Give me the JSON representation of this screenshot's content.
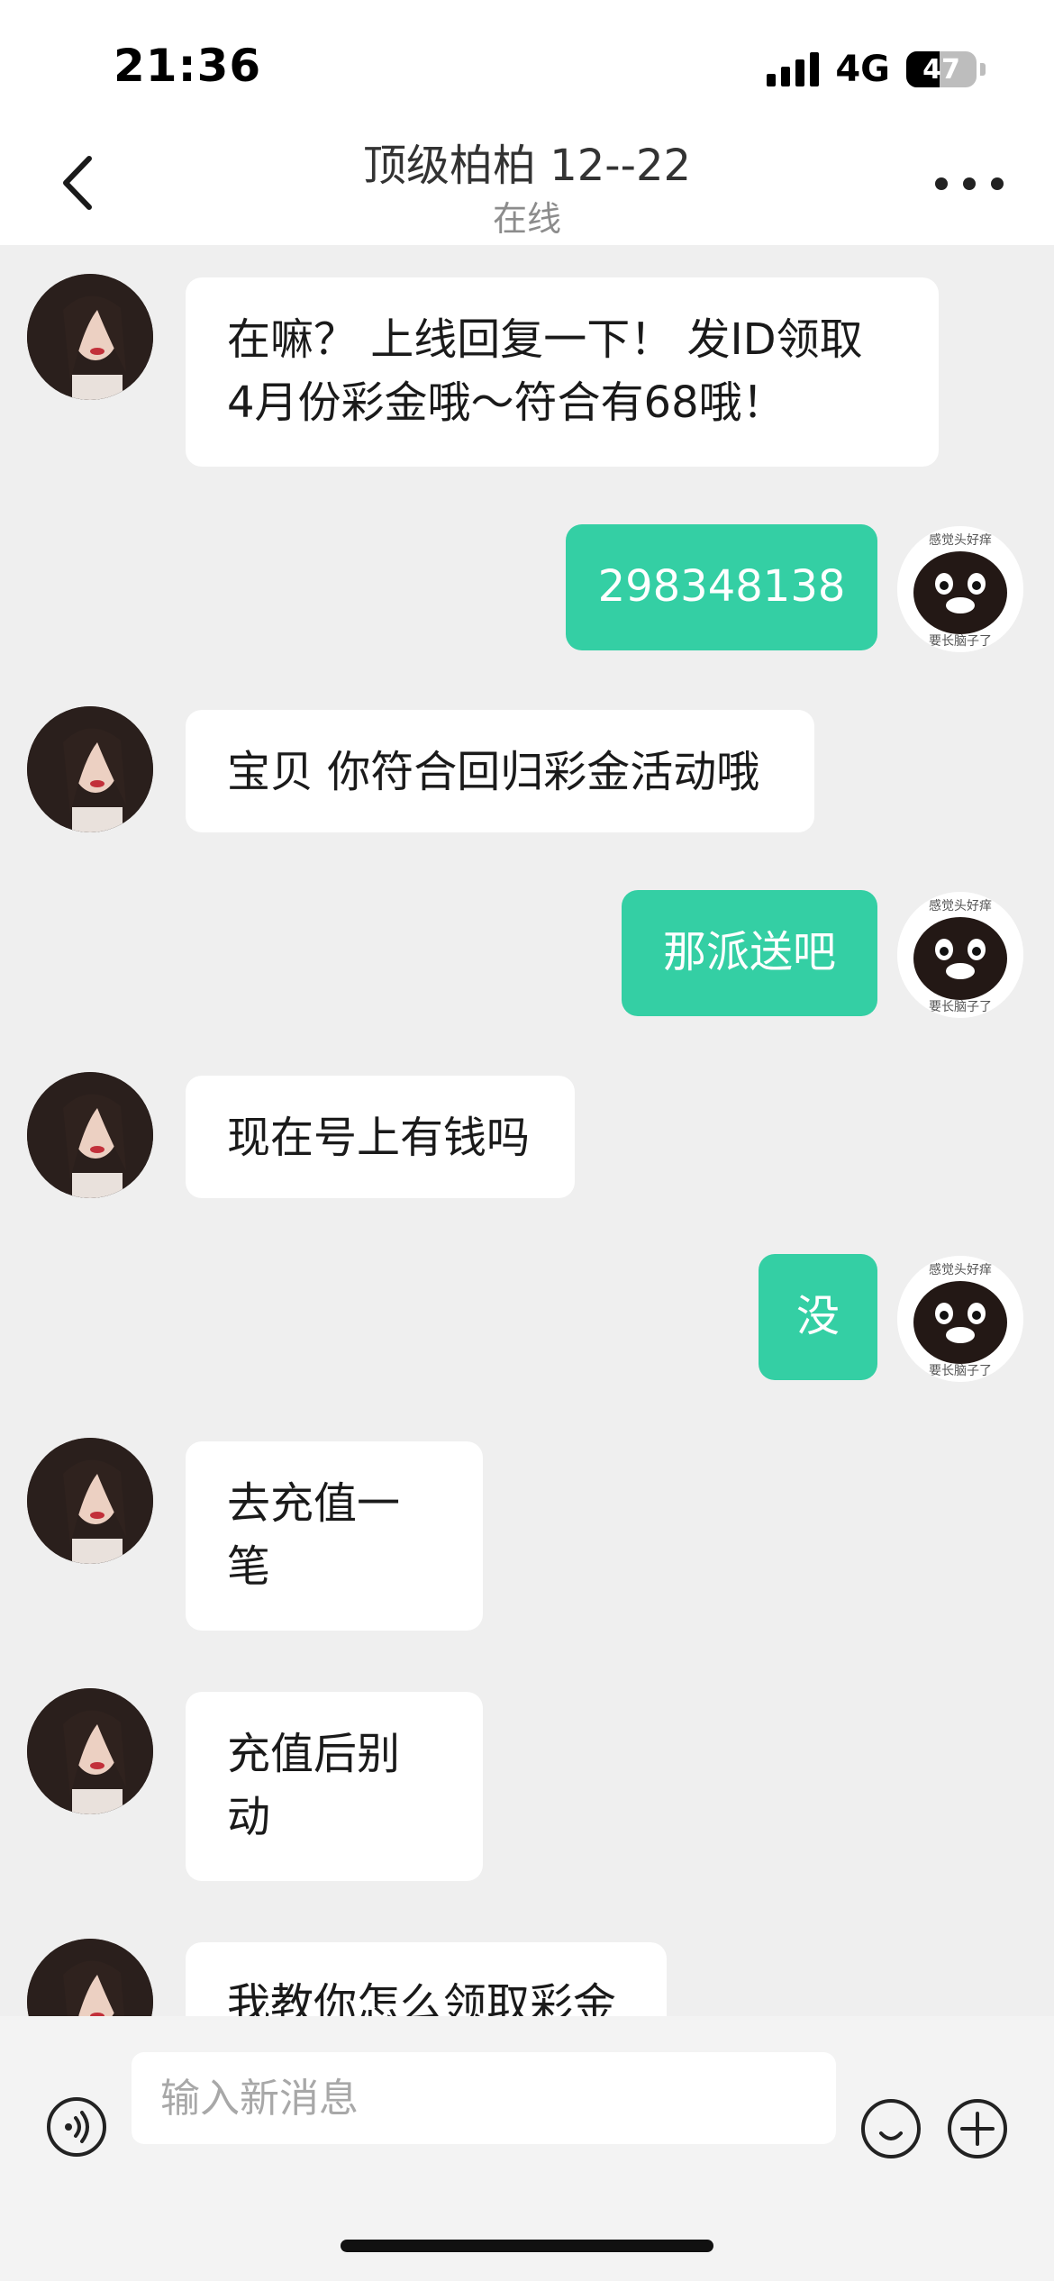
{
  "status_bar": {
    "time": "21:36",
    "network": "4G",
    "battery": "47",
    "battery_level": 0.47
  },
  "header": {
    "title": "顶级柏柏 12--22",
    "subtitle": "在线",
    "back_icon": "chevron-left-icon",
    "more_icon": "ellipsis-icon"
  },
  "messages": [
    {
      "sender": "them",
      "text": "在嘛？ 上线回复一下！ 发ID领取\n4月份彩金哦～符合有68哦！"
    },
    {
      "sender": "me",
      "text": "298348138"
    },
    {
      "sender": "them",
      "text": "宝贝 你符合回归彩金活动哦"
    },
    {
      "sender": "me",
      "text": "那派送吧"
    },
    {
      "sender": "them",
      "text": "现在号上有钱吗"
    },
    {
      "sender": "me",
      "text": "没"
    },
    {
      "sender": "them",
      "text": "去充值一笔"
    },
    {
      "sender": "them",
      "text": "充值后别动"
    },
    {
      "sender": "them",
      "text": "我教你怎么领取彩金"
    }
  ],
  "me_avatar_caption_top": "感觉头好痒",
  "me_avatar_caption_bottom": "要长脑子了",
  "input_bar": {
    "placeholder": "输入新消息",
    "voice_icon": "voice-icon",
    "emoji_icon": "emoji-icon",
    "plus_icon": "plus-icon"
  },
  "colors": {
    "my_bubble": "#34cfa4",
    "their_bubble": "#ffffff",
    "chat_background": "#efefef"
  }
}
